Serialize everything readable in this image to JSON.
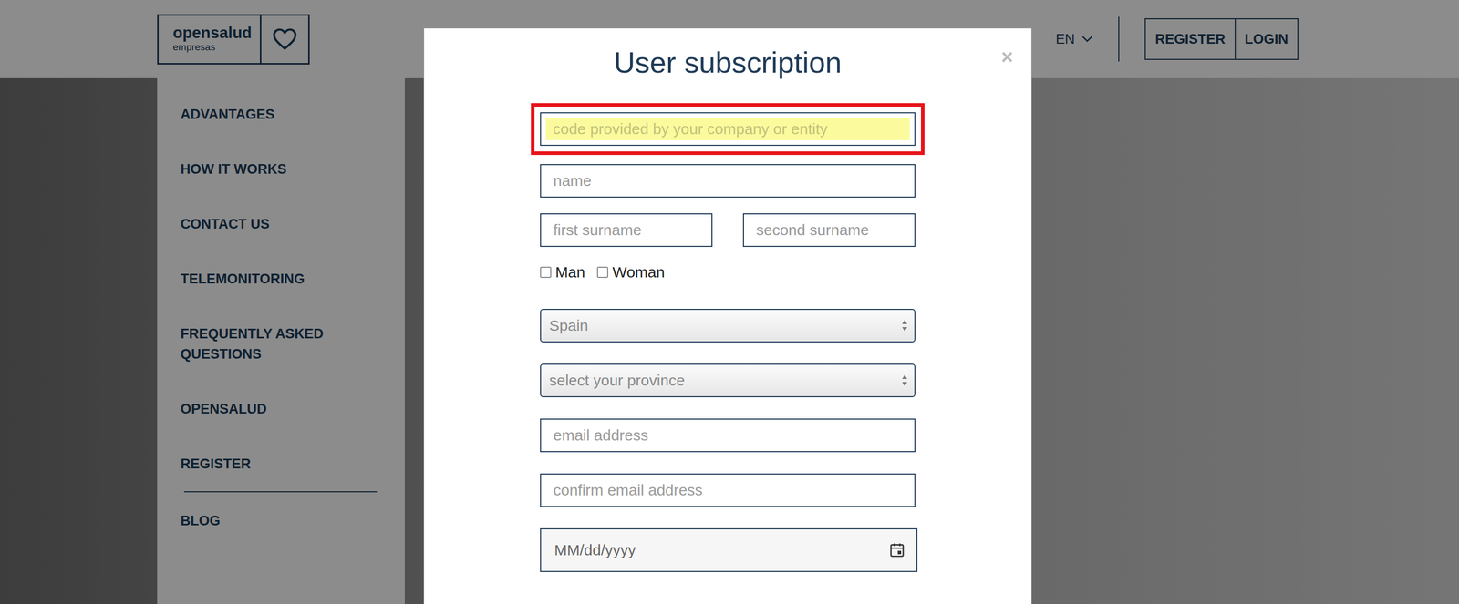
{
  "header": {
    "logo": {
      "name": "opensalud",
      "sub": "empresas"
    },
    "language": "EN",
    "buttons": [
      "REGISTER",
      "LOGIN"
    ]
  },
  "sidebar": {
    "items": [
      "ADVANTAGES",
      "HOW IT WORKS",
      "CONTACT US",
      "TELEMONITORING",
      "FREQUENTLY ASKED QUESTIONS",
      "OPENSALUD",
      "REGISTER"
    ],
    "extra_items": [
      "BLOG"
    ]
  },
  "modal": {
    "title": "User subscription",
    "close": "×",
    "code_field": {
      "placeholder": "code provided by your company or entity",
      "highlighted": true
    },
    "name_field": {
      "placeholder": "name"
    },
    "surname_fields": [
      {
        "placeholder": "first surname"
      },
      {
        "placeholder": "second surname"
      }
    ],
    "gender": [
      {
        "label": "Man",
        "checked": false
      },
      {
        "label": "Woman",
        "checked": false
      }
    ],
    "country_select": {
      "value": "Spain"
    },
    "province_select": {
      "value": "select your province"
    },
    "email_field": {
      "placeholder": "email address"
    },
    "confirm_email_field": {
      "placeholder": "confirm email address"
    },
    "date_field": {
      "value": "MM/dd/yyyy"
    }
  }
}
